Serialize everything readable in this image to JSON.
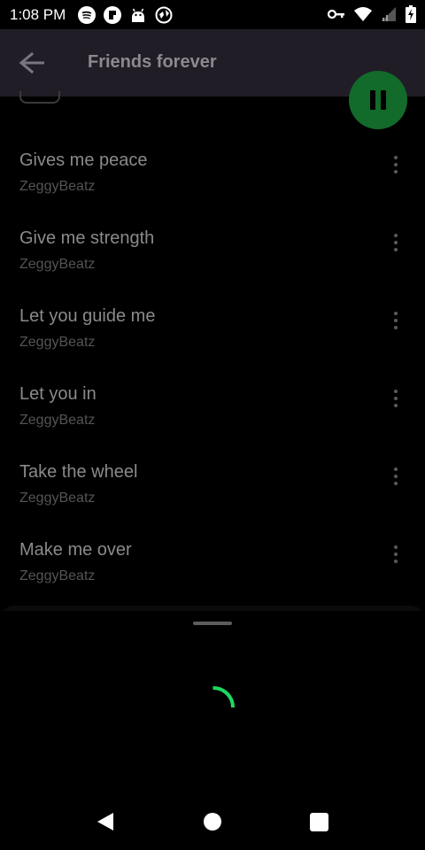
{
  "status_bar": {
    "time": "1:08 PM",
    "notification_icons": [
      "spotify-icon",
      "app-icon",
      "android-robot-icon",
      "vpn-globe-icon"
    ],
    "system_icons": [
      "vpn-key-icon",
      "wifi-icon",
      "cell-signal-icon",
      "battery-charging-icon"
    ]
  },
  "app_bar": {
    "title": "Friends forever",
    "back_icon": "arrow-left-icon"
  },
  "fab": {
    "icon": "pause-icon",
    "color": "#126a2b"
  },
  "tracks": [
    {
      "title": "Gives me peace",
      "artist": "ZeggyBeatz"
    },
    {
      "title": "Give me strength",
      "artist": "ZeggyBeatz"
    },
    {
      "title": "Let you guide me",
      "artist": "ZeggyBeatz"
    },
    {
      "title": "Let you in",
      "artist": "ZeggyBeatz"
    },
    {
      "title": "Take the wheel",
      "artist": "ZeggyBeatz"
    },
    {
      "title": "Make me over",
      "artist": "ZeggyBeatz"
    }
  ],
  "bottom_sheet": {
    "state": "loading",
    "spinner_color": "#1ed760"
  },
  "nav_bar": [
    "back-triangle-icon",
    "home-circle-icon",
    "recents-square-icon"
  ]
}
